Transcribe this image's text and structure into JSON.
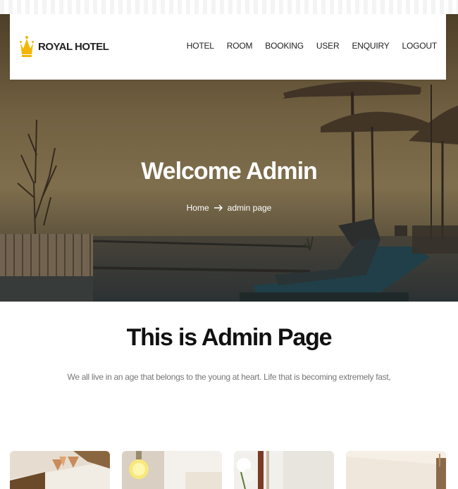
{
  "brand": {
    "name": "ROYAL HOTEL",
    "crown_color": "#f2b705"
  },
  "nav": {
    "items": [
      {
        "label": "HOTEL"
      },
      {
        "label": "ROOM"
      },
      {
        "label": "BOOKING"
      },
      {
        "label": "USER"
      },
      {
        "label": "ENQUIRY"
      },
      {
        "label": "LOGOUT"
      }
    ]
  },
  "hero": {
    "title": "Welcome Admin",
    "breadcrumb_home": "Home",
    "breadcrumb_current": "admin page"
  },
  "intro": {
    "title": "This is Admin Page",
    "text": "We all live in an age that belongs to the young at heart. Life that is becoming extremely fast,"
  },
  "cards": [
    {
      "name": "room-card-1"
    },
    {
      "name": "room-card-2"
    },
    {
      "name": "room-card-3"
    },
    {
      "name": "room-card-4"
    }
  ]
}
